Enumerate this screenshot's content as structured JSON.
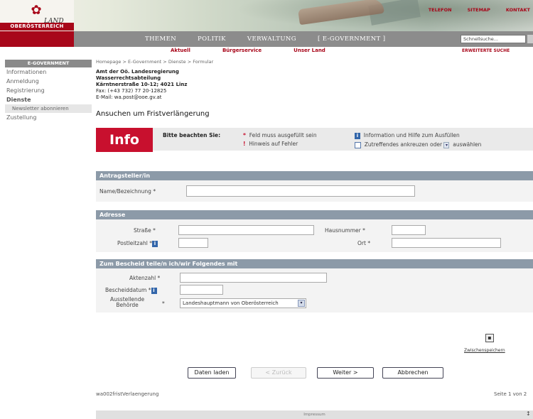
{
  "header": {
    "logo_land": "LAND",
    "logo_region": "OBERÖSTERREICH",
    "top_links": [
      "TELEFON",
      "SITEMAP",
      "KONTAKT"
    ]
  },
  "nav": {
    "items": [
      "THEMEN",
      "POLITIK",
      "VERWALTUNG",
      "[ E-GOVERNMENT ]"
    ],
    "search_value": "Schnellsuche..."
  },
  "subnav": {
    "items": [
      "Aktuell",
      "Bürgerservice",
      "Unser Land"
    ],
    "extended_search": "ERWEITERTE SUCHE"
  },
  "sidebar": {
    "heading": "E-GOVERNMENT",
    "items": [
      {
        "label": "Informationen"
      },
      {
        "label": "Anmeldung"
      },
      {
        "label": "Registrierung"
      },
      {
        "label": "Dienste"
      },
      {
        "label": "Newsletter abonnieren"
      },
      {
        "label": "Zustellung"
      }
    ]
  },
  "content": {
    "breadcrumb": "Homepage > E-Government > Dienste > Formular",
    "authority": "Amt der Oö. Landesregierung",
    "department": "Wasserrechtsabteilung",
    "street": "Kärntnerstraße 10-12; 4021 Linz",
    "fax": "Fax: (+43 732) 77 20-12825",
    "email": "E-Mail: wa.post@ooe.gv.at",
    "title": "Ansuchen um Fristverlängerung"
  },
  "info": {
    "button": "Info",
    "label": "Bitte beachten Sie:",
    "required": "Feld muss ausgefüllt sein",
    "error_hint": "Hinweis auf Fehler",
    "help": "Information und Hilfe zum Ausfüllen",
    "check": "Zutreffendes ankreuzen oder",
    "select": "auswählen"
  },
  "sections": {
    "applicant": {
      "title": "Antragsteller/in",
      "name_label": "Name/Bezeichnung",
      "name_value": ""
    },
    "address": {
      "title": "Adresse",
      "street_label": "Straße",
      "house_label": "Hausnummer",
      "zip_label": "Postleitzahl",
      "city_label": "Ort",
      "street_value": "",
      "house_value": "",
      "zip_value": "",
      "city_value": ""
    },
    "decision": {
      "title": "Zum Bescheid teile/n ich/wir Folgendes mit",
      "file_label": "Aktenzahl",
      "date_label": "Bescheiddatum",
      "authority_label_1": "Ausstellende",
      "authority_label_2": "Behörde",
      "authority_value": "Landeshauptmann von Oberösterreich",
      "file_value": "",
      "date_value": ""
    }
  },
  "actions": {
    "save_label": "Zwischenspeichern",
    "load": "Daten laden",
    "back": "< Zurück",
    "next": "Weiter >",
    "cancel": "Abbrechen"
  },
  "footer": {
    "form_id": "wa002fristVerlaengerung",
    "page": "Seite 1 von 2",
    "impressum": "Impressum"
  },
  "colors": {
    "brand_red": "#a8071a",
    "info_red": "#c8102e",
    "section_blue_gray": "#8c9aa8",
    "nav_gray": "#8c8c8c"
  }
}
